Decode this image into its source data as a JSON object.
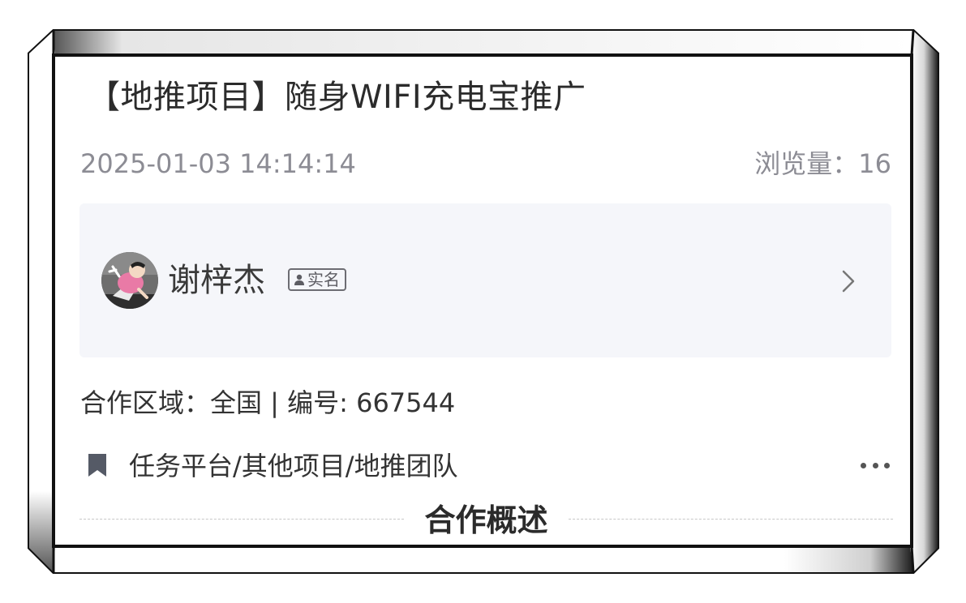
{
  "post": {
    "title": "【地推项目】随身WIFI充电宝推广",
    "date": "2025-01-03 14:14:14",
    "views_label": "浏览量：",
    "views_count": "16"
  },
  "publisher": {
    "name": "谢梓杰",
    "badge_label": "实名"
  },
  "details": {
    "region_line": "合作区域：全国 | 编号: 667544",
    "category_path": "任务平台/其他项目/地推团队"
  },
  "section": {
    "title": "合作概述"
  },
  "icons": {
    "bookmark": "bookmark-icon",
    "more": "more-icon",
    "chevron": "chevron-right-icon",
    "badge_person": "person-icon"
  },
  "colors": {
    "text_primary": "#2b2b2b",
    "text_muted": "#8c8c94",
    "card_bg": "#f5f6fa"
  }
}
